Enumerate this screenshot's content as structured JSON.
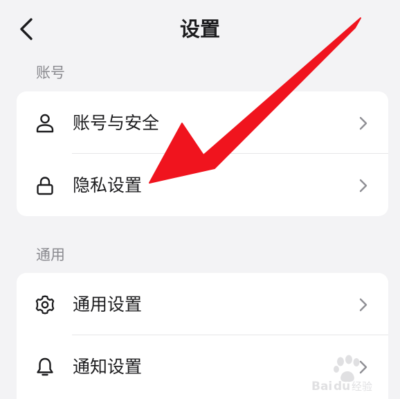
{
  "header": {
    "title": "设置",
    "back_icon": "chevron-left-icon"
  },
  "sections": [
    {
      "label": "账号",
      "items": [
        {
          "label": "账号与安全",
          "icon": "user-icon"
        },
        {
          "label": "隐私设置",
          "icon": "lock-icon"
        }
      ]
    },
    {
      "label": "通用",
      "items": [
        {
          "label": "通用设置",
          "icon": "gear-icon"
        },
        {
          "label": "通知设置",
          "icon": "bell-icon"
        }
      ]
    }
  ],
  "annotation": {
    "color": "#f0141e",
    "icon": "red-arrow-annotation"
  },
  "watermark": {
    "text": "Baidu经验",
    "icon": "baidu-paw-logo"
  },
  "colors": {
    "background": "#f3f3f5",
    "card": "#ffffff",
    "section_label": "#8a8a8f",
    "text": "#1c1c1e",
    "chevron": "#8e8e93"
  }
}
